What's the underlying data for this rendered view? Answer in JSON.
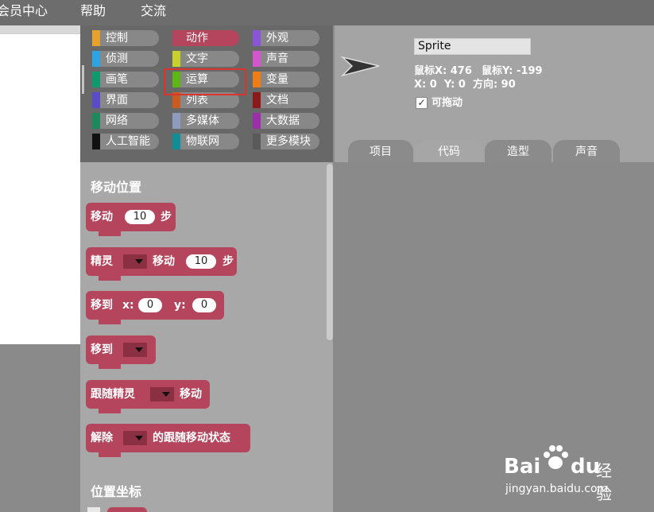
{
  "menu": {
    "items": [
      "会员中心",
      "帮助",
      "交流"
    ]
  },
  "categories": [
    {
      "label": "控制",
      "color": "#e6a22c"
    },
    {
      "label": "动作",
      "color": "#b4455c",
      "active": true
    },
    {
      "label": "外观",
      "color": "#8a55d7"
    },
    {
      "label": "侦测",
      "color": "#2ca5e2"
    },
    {
      "label": "文字",
      "color": "#c7d22a"
    },
    {
      "label": "声音",
      "color": "#d456cf"
    },
    {
      "label": "画笔",
      "color": "#0e9a6c"
    },
    {
      "label": "运算",
      "color": "#5cb712"
    },
    {
      "label": "变量",
      "color": "#ee7d16"
    },
    {
      "label": "界面",
      "color": "#5a4bc7"
    },
    {
      "label": "列表",
      "color": "#cc5b22"
    },
    {
      "label": "文档",
      "color": "#8b1a1a"
    },
    {
      "label": "网络",
      "color": "#1d8a5e"
    },
    {
      "label": "多媒体",
      "color": "#8e9bbf"
    },
    {
      "label": "大数据",
      "color": "#9a2fa8"
    },
    {
      "label": "人工智能",
      "color": "#111111"
    },
    {
      "label": "物联网",
      "color": "#118d96"
    },
    {
      "label": "更多模块",
      "color": "#5a5a5a"
    }
  ],
  "palette": {
    "section_move": "移动位置",
    "section_coords": "位置坐标",
    "blocks": {
      "move": {
        "label": "移动",
        "value": "10",
        "suffix": "步"
      },
      "sprite_move": {
        "label": "精灵",
        "verb": "移动",
        "value": "10",
        "suffix": "步"
      },
      "goto_xy": {
        "label": "移到",
        "x_label": "x:",
        "x": "0",
        "y_label": "y:",
        "y": "0"
      },
      "goto": {
        "label": "移到"
      },
      "follow": {
        "label": "跟随精灵",
        "verb": "移动"
      },
      "unfollow": {
        "label": "解除",
        "suffix": "的跟随移动状态"
      }
    }
  },
  "sprite": {
    "name": "Sprite",
    "mouse_x": "鼠标X: 476",
    "mouse_y": "鼠标Y: -199",
    "pos": "X: 0  Y: 0  方向: 90",
    "draggable_label": "可拖动",
    "draggable_check": "✓"
  },
  "tabs": [
    "项目",
    "代码",
    "造型",
    "声音"
  ],
  "watermark": {
    "text": "jingyan.baidu.com",
    "brand": "Bai",
    "brand2": "du",
    "brand3": "经验"
  }
}
